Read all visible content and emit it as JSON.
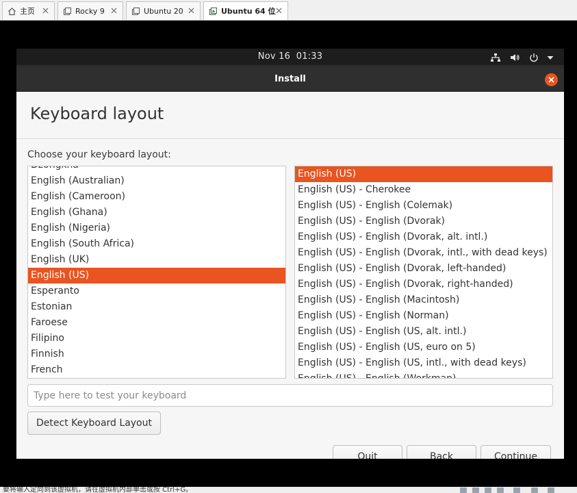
{
  "host": {
    "tabs": [
      {
        "label": "主页",
        "icon": "home-icon"
      },
      {
        "label": "Rocky 9",
        "icon": "vm-icon"
      },
      {
        "label": "Ubuntu 20",
        "icon": "vm-icon"
      },
      {
        "label": "Ubuntu 64 位",
        "icon": "vm-running-icon",
        "active": true
      }
    ],
    "status_text": "要将输入定向到该虚拟机，请在虚拟机内部单击或按 Ctrl+G。"
  },
  "topbar": {
    "date": "Nov 16",
    "time": "01:33",
    "tray_icons": [
      "network-icon",
      "volume-icon",
      "power-icon",
      "menu-arrow-icon"
    ]
  },
  "window": {
    "title": "Install",
    "accent_color": "#e95420"
  },
  "page": {
    "title": "Keyboard layout",
    "choose_label": "Choose your keyboard layout:"
  },
  "layouts": {
    "items": [
      "Dzongkha",
      "English (Australian)",
      "English (Cameroon)",
      "English (Ghana)",
      "English (Nigeria)",
      "English (South Africa)",
      "English (UK)",
      "English (US)",
      "Esperanto",
      "Estonian",
      "Faroese",
      "Filipino",
      "Finnish",
      "French"
    ],
    "selected": "English (US)"
  },
  "variants": {
    "items": [
      "English (US)",
      "English (US) - Cherokee",
      "English (US) - English (Colemak)",
      "English (US) - English (Dvorak)",
      "English (US) - English (Dvorak, alt. intl.)",
      "English (US) - English (Dvorak, intl., with dead keys)",
      "English (US) - English (Dvorak, left-handed)",
      "English (US) - English (Dvorak, right-handed)",
      "English (US) - English (Macintosh)",
      "English (US) - English (Norman)",
      "English (US) - English (US, alt. intl.)",
      "English (US) - English (US, euro on 5)",
      "English (US) - English (US, intl., with dead keys)",
      "English (US) - English (Workman)"
    ],
    "selected": "English (US)"
  },
  "test_input": {
    "placeholder": "Type here to test your keyboard",
    "value": ""
  },
  "buttons": {
    "detect": "Detect Keyboard Layout",
    "quit": "Quit",
    "back": "Back",
    "continue": "Continue"
  }
}
